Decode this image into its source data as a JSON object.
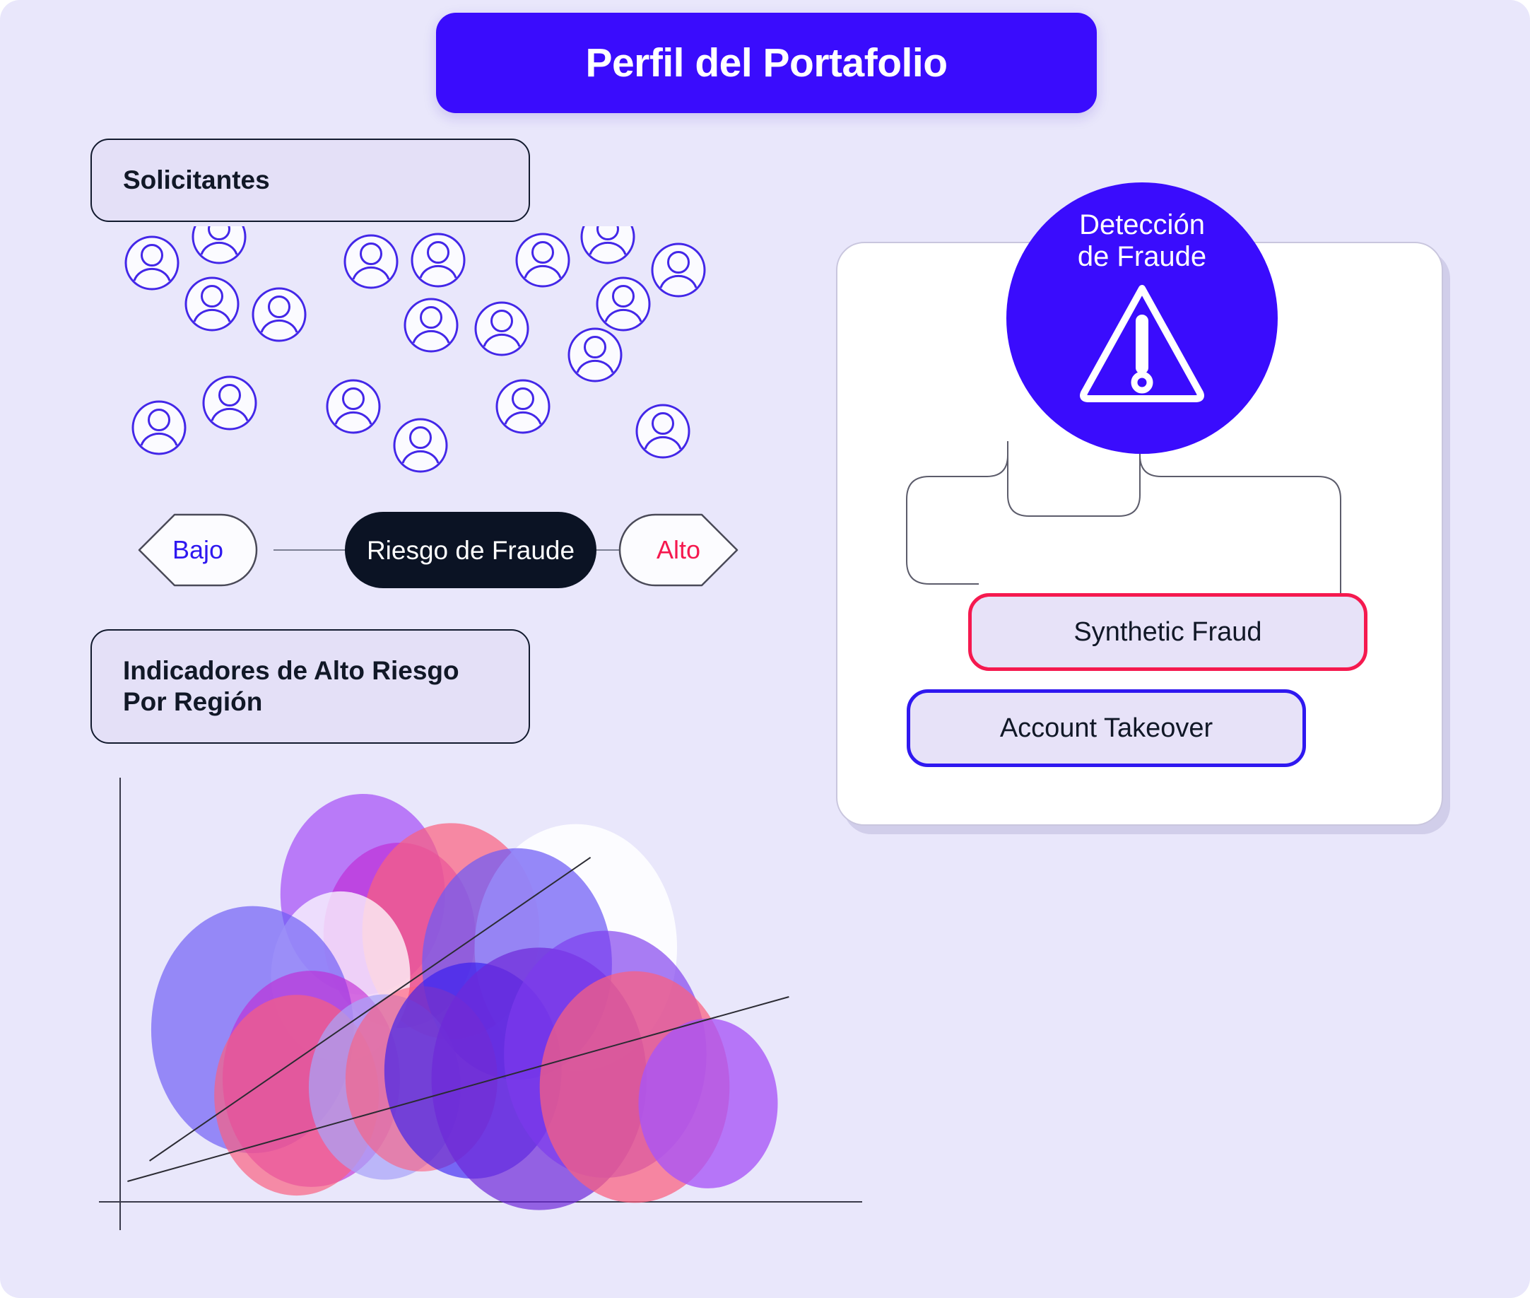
{
  "header": {
    "title": "Perfil del Portafolio",
    "bar_color": "#3a0cfd",
    "text_color": "#ffffff"
  },
  "page": {
    "background_color": "#e9e7fb"
  },
  "left_panel": {
    "applicants_label": "Solicitantes",
    "risk_indicators_label": "Indicadores de Alto Riesgo Por Región",
    "risk_indicators_line1": "Indicadores de Alto Riesgo",
    "risk_indicators_line2": "Por Región",
    "avatar_count": 19,
    "avatar_stroke_color": "#4327e8"
  },
  "risk_scale": {
    "low_label": "Bajo",
    "low_color": "#2f18f0",
    "center_label": "Riesgo de Fraude",
    "center_bg": "#0b1324",
    "center_text_color": "#ffffff",
    "high_label": "Alto",
    "high_color": "#f5194f"
  },
  "fraud_panel": {
    "circle_label": "Detección\nde Fraude",
    "circle_color": "#3a0cfd",
    "icon": "warning-triangle-icon",
    "items": [
      {
        "label": "Synthetic Fraud",
        "border_color": "#f5194f"
      },
      {
        "label": "Account Takeover",
        "border_color": "#2f18f0"
      }
    ]
  },
  "chart_data": {
    "type": "scatter",
    "title": "Indicadores de Alto Riesgo Por Región",
    "xlabel": "",
    "ylabel": "",
    "grid": false,
    "legend": "none",
    "xlim": [
      0,
      100
    ],
    "ylim": [
      0,
      100
    ],
    "note": "Bubble scatter of regional high-risk indicators with two fitted trend lines",
    "bubbles": [
      {
        "x": 33,
        "y": 75,
        "r": 13,
        "color": "#a855f7",
        "opacity": 0.75
      },
      {
        "x": 38,
        "y": 65,
        "r": 12,
        "color": "#c026d3",
        "opacity": 0.62
      },
      {
        "x": 45,
        "y": 66,
        "r": 14,
        "color": "#fb5f7e",
        "opacity": 0.7
      },
      {
        "x": 30,
        "y": 55,
        "r": 11,
        "color": "#ffffff",
        "opacity": 0.75
      },
      {
        "x": 62,
        "y": 62,
        "r": 16,
        "color": "#ffffff",
        "opacity": 0.85
      },
      {
        "x": 54,
        "y": 58,
        "r": 15,
        "color": "#6d5cf5",
        "opacity": 0.72
      },
      {
        "x": 18,
        "y": 42,
        "r": 16,
        "color": "#6d5cf5",
        "opacity": 0.68
      },
      {
        "x": 26,
        "y": 30,
        "r": 14,
        "color": "#c026d3",
        "opacity": 0.62
      },
      {
        "x": 24,
        "y": 26,
        "r": 13,
        "color": "#fb5f7e",
        "opacity": 0.68
      },
      {
        "x": 36,
        "y": 28,
        "r": 12,
        "color": "#a9a3f8",
        "opacity": 0.72
      },
      {
        "x": 41,
        "y": 30,
        "r": 12,
        "color": "#fb5f7e",
        "opacity": 0.62
      },
      {
        "x": 48,
        "y": 32,
        "r": 14,
        "color": "#2f18f0",
        "opacity": 0.62
      },
      {
        "x": 57,
        "y": 30,
        "r": 17,
        "color": "#6d28d9",
        "opacity": 0.7
      },
      {
        "x": 66,
        "y": 36,
        "r": 16,
        "color": "#7c3aed",
        "opacity": 0.66
      },
      {
        "x": 70,
        "y": 28,
        "r": 15,
        "color": "#fb5f7e",
        "opacity": 0.72
      },
      {
        "x": 80,
        "y": 24,
        "r": 11,
        "color": "#a855f7",
        "opacity": 0.78
      }
    ],
    "trend_lines": [
      {
        "x1": 4,
        "y1": 10,
        "x2": 64,
        "y2": 84,
        "color": "#2b2b33"
      },
      {
        "x1": 1,
        "y1": 5,
        "x2": 91,
        "y2": 50,
        "color": "#2b2b33"
      }
    ],
    "axes": {
      "x_axis": true,
      "y_axis": true,
      "axis_color": "#3a3a4a"
    }
  }
}
